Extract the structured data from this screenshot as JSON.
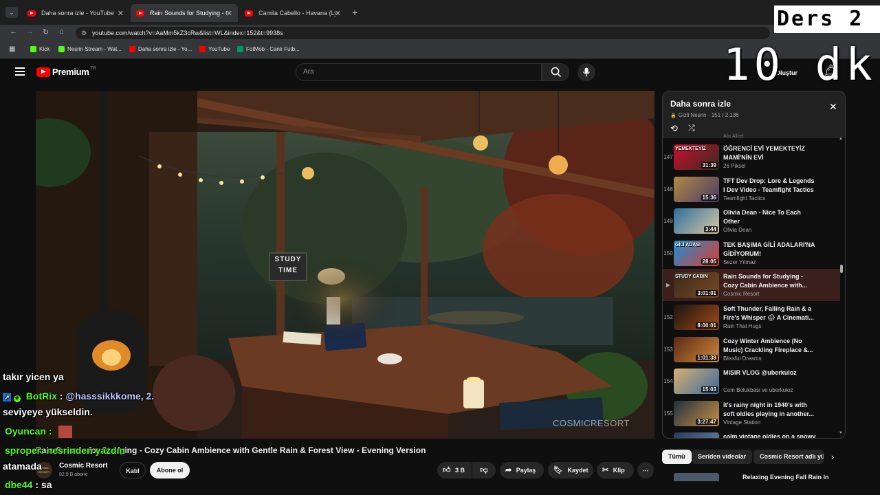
{
  "browser": {
    "tabs": [
      {
        "title": "Daha sonra izle - YouTube",
        "active": false
      },
      {
        "title": "Rain Sounds for Studying - Coz",
        "active": true
      },
      {
        "title": "Camila Cabello - Havana (Lyric",
        "active": false
      }
    ],
    "url": "youtube.com/watch?v=AaMm5kZ3cRw&list=WL&index=152&t=9938s",
    "bookmarks": [
      "Kick",
      "Nesrin Stream - Wat...",
      "Daha sonra izle - Yo...",
      "YouTube",
      "FotMob - Canlı Futb..."
    ]
  },
  "overlay": {
    "ders": "Ders 2",
    "dk": "10 dk"
  },
  "header": {
    "logo": "Premium",
    "region": "TR",
    "search_placeholder": "Ara",
    "create": "Oluştur"
  },
  "video": {
    "title": "Rain Sounds for Studying - Cozy Cabin Ambience with Gentle Rain & Forest View - Evening Version",
    "study_sign": [
      "STUDY",
      "TIME"
    ],
    "watermark": "COSMICRESORT"
  },
  "channel": {
    "name": "Cosmic Resort",
    "subs": "82.9 B abone",
    "avatar_text": "COSMIC RESORT",
    "join": "Katıl",
    "subscribe": "Abone ol"
  },
  "actions": {
    "likes": "3 B",
    "share": "Paylaş",
    "save": "Kaydet",
    "clip": "Klip",
    "more": "⋯"
  },
  "playlist": {
    "title": "Daha sonra izle",
    "meta": "Gizli Nesrin · 151 / 2.136",
    "partial_top": "Alix Allcel",
    "items": [
      {
        "idx": "147",
        "title": "ÖĞRENCİ EVİ YEMEKTEYİZ MAMİ'NİN EVİ",
        "channel": "26 Piksel",
        "duration": "31:39",
        "thumb": "YEMEKTEYİZ",
        "c1": "#c8102e",
        "c2": "#3a2a20"
      },
      {
        "idx": "148",
        "title": "TFT Dev Drop: Lore & Legends I Dev Video - Teamfight Tactics",
        "channel": "Teamfight Tactics",
        "duration": "15:36",
        "thumb": "",
        "c1": "#b08a3e",
        "c2": "#4a3a6a"
      },
      {
        "idx": "149",
        "title": "Olivia Dean - Nice To Each Other",
        "channel": "Olivia Dean",
        "duration": "3:44",
        "thumb": "",
        "c1": "#2d6fa0",
        "c2": "#d9c8a0"
      },
      {
        "idx": "150",
        "title": "TEK BAŞIMA GİLİ ADALARI'NA GİDİYORUM!",
        "channel": "Sezer Yılmaz",
        "duration": "28:05",
        "thumb": "GİLİ ADASI",
        "c1": "#1a8ed6",
        "c2": "#e03c2c"
      },
      {
        "idx": "▶",
        "title": "Rain Sounds for Studying - Cozy Cabin Ambience with...",
        "channel": "Cosmic Resort",
        "duration": "3:01:01",
        "thumb": "STUDY CABIN",
        "c1": "#3b2a1e",
        "c2": "#7a4a22",
        "current": true
      },
      {
        "idx": "152",
        "title": "Soft Thunder, Falling Rain & a Fire's Whisper 🌧 A Cinemati...",
        "channel": "Rain That Hugs",
        "duration": "8:00:01",
        "thumb": "",
        "c1": "#1b1410",
        "c2": "#a04a18"
      },
      {
        "idx": "153",
        "title": "Cozy Winter Ambience (No Music) Crackling Fireplace &...",
        "channel": "Blissful Dreams",
        "duration": "1:01:39",
        "thumb": "",
        "c1": "#5a2a14",
        "c2": "#d0883a"
      },
      {
        "idx": "154",
        "title": "MISIR VLOG @uberkuloz",
        "channel": "Cem Bolukbasi ve uberkuloz",
        "duration": "15:03",
        "thumb": "",
        "c1": "#d8b070",
        "c2": "#3a6aa0"
      },
      {
        "idx": "155",
        "title": "it's rainy night in 1940's with soft oldies playing in another...",
        "channel": "Vintage Station",
        "duration": "3:27:47",
        "thumb": "",
        "c1": "#203040",
        "c2": "#c89040"
      },
      {
        "idx": "156",
        "title": "calm vintage oldies on a snowy",
        "channel": "",
        "duration": "",
        "thumb": "",
        "c1": "#2a3a5a",
        "c2": "#6a8ab0"
      }
    ]
  },
  "chips": [
    "Tümü",
    "Seriden videolar",
    "Cosmic Resort adlı yü"
  ],
  "next_partial": "Relaxing Evening Fall Rain In",
  "chat": {
    "l1": "takır yicen ya",
    "botrix_name": "BotRix",
    "botrix_msg": "@hasssikkkome, 2.",
    "l3": "seviyeye yükseldin.",
    "oyuncan": "Oyuncan :",
    "sprope": "sproper: nesrinden yazdın",
    "atamada": "atamada",
    "dbe": "dbe44",
    "dbe_msg": ": sa",
    "colon": ":"
  }
}
